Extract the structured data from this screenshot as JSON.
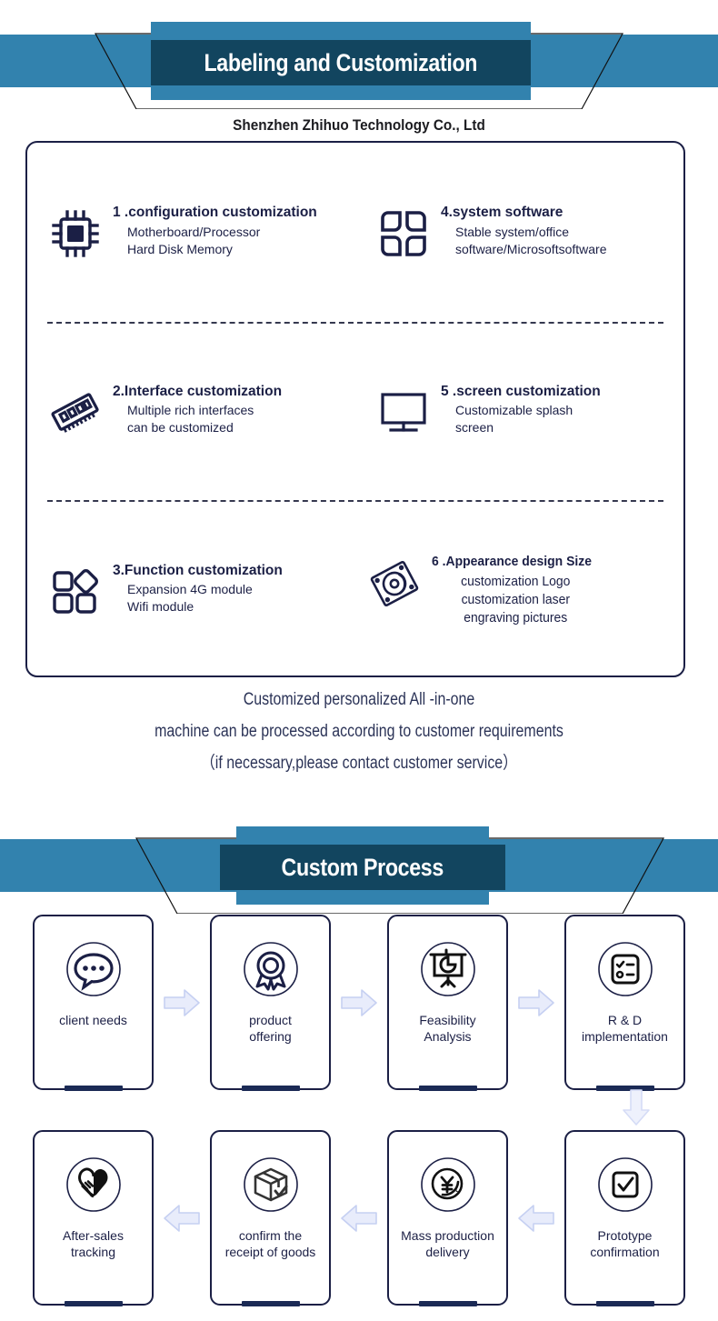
{
  "banner_top": {
    "title": "Labeling and Customization",
    "subtitle": "Shenzhen Zhihuo Technology Co., Ltd",
    "band_color": "#3282ae",
    "title_block_color": "#12455f"
  },
  "features": [
    {
      "index": "1",
      "icon": "cpu-chip-icon",
      "title": "1 .configuration customization",
      "desc_lines": [
        "Motherboard/Processor",
        "Hard Disk Memory"
      ]
    },
    {
      "index": "4",
      "icon": "four-petals-icon",
      "title": "4.system software",
      "desc_lines": [
        "Stable system/office",
        "software/Microsoftsoftware"
      ]
    },
    {
      "index": "2",
      "icon": "ram-module-icon",
      "title": "2.Interface customization",
      "desc_lines": [
        "Multiple rich interfaces",
        "can be customized"
      ]
    },
    {
      "index": "5",
      "icon": "monitor-icon",
      "title": "5 .screen customization",
      "desc_lines": [
        "Customizable splash",
        "screen"
      ]
    },
    {
      "index": "3",
      "icon": "four-shapes-icon",
      "title": "3.Function customization",
      "desc_lines": [
        "Expansion 4G module",
        "Wifi module"
      ]
    },
    {
      "index": "6",
      "icon": "hard-disk-icon",
      "title": "6 .Appearance design Size",
      "desc_lines": [
        "customization Logo",
        "customization laser",
        "engraving pictures"
      ]
    }
  ],
  "caption": {
    "line1": "Customized personalized  All -in-one",
    "line2": "machine can be processed according to customer requirements",
    "line3": "（if necessary,please contact customer service）"
  },
  "banner_process": {
    "title": "Custom Process"
  },
  "process": {
    "row1": [
      {
        "icon": "speech-bubble-icon",
        "label_lines": [
          "client needs"
        ]
      },
      {
        "icon": "award-ribbon-icon",
        "label_lines": [
          "product",
          "offering"
        ]
      },
      {
        "icon": "presentation-chart-icon",
        "label_lines": [
          "Feasibility",
          "Analysis"
        ]
      },
      {
        "icon": "checklist-clipboard-icon",
        "label_lines": [
          "R & D",
          "implementation"
        ]
      }
    ],
    "row2": [
      {
        "icon": "handshake-heart-icon",
        "label_lines": [
          "After-sales",
          "tracking"
        ]
      },
      {
        "icon": "package-check-icon",
        "label_lines": [
          "confirm the",
          "receipt of goods"
        ]
      },
      {
        "icon": "yen-coin-icon",
        "label_lines": [
          "Mass production",
          "delivery"
        ]
      },
      {
        "icon": "checkbox-tick-icon",
        "label_lines": [
          "Prototype",
          "confirmation"
        ]
      }
    ],
    "arrow_color": "#e8ecfb",
    "arrow_border": "#c6d0f2"
  }
}
